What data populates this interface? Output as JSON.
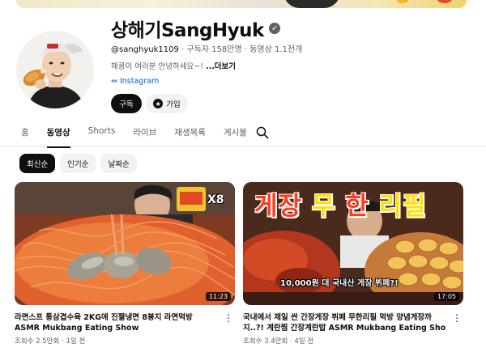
{
  "channel": {
    "name": "상해기SangHyuk",
    "handle": "@sanghyuk1109",
    "subscribers": "구독자 158만명",
    "videos": "동영상 1.1천개",
    "description": "해콩이 여러분 안녕하세요~!",
    "more": "...더보기",
    "link": "Instagram",
    "subscribe_label": "구독",
    "join_label": "가입"
  },
  "tabs": [
    {
      "label": "홈"
    },
    {
      "label": "동영상",
      "active": true
    },
    {
      "label": "Shorts"
    },
    {
      "label": "라이브"
    },
    {
      "label": "재생목록"
    },
    {
      "label": "게시물"
    }
  ],
  "chips": [
    {
      "label": "최신순",
      "active": true
    },
    {
      "label": "인기순"
    },
    {
      "label": "날짜순"
    }
  ],
  "videos": [
    {
      "title_line1": "라면스프 통삼겹수육 2KG에 진짤냉면 8봉지 라면먹방",
      "title_line2": "ASMR Mukbang Eating Show",
      "views": "조회수 2.5만회",
      "age": "1일 전",
      "duration": "11:23",
      "overlay": "X8"
    },
    {
      "title_line1": "국내에서 제일 싼 간장게장 뷔페 무한리필 먹방 양념게장까",
      "title_line2": "지..?! 계란찜 간장계란밥 ASMR Mukbang Eating Show",
      "views": "조회수 3.4만회",
      "age": "4일 전",
      "duration": "17:05",
      "overlay_a": "게장",
      "overlay_b": "무",
      "overlay_c": "한",
      "overlay_d": "리필",
      "caption": "10,000원 대 국내산 게장 뷔페?!"
    }
  ],
  "icons": [
    "verified-check-icon",
    "link-icon",
    "star-icon",
    "search-icon",
    "more-vert-icon"
  ]
}
